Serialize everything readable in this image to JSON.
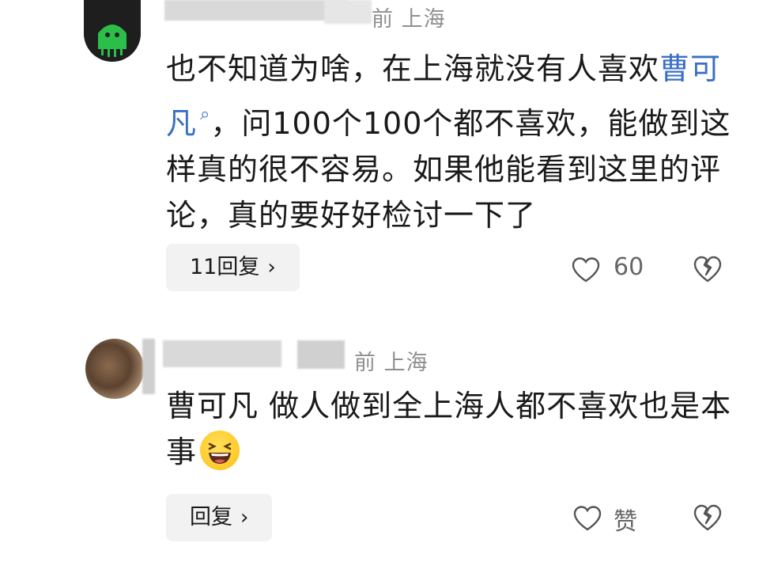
{
  "comments": [
    {
      "location": "前 上海",
      "text_before": "也不知道为啥，在上海就没有人喜欢",
      "mention": "曹可凡",
      "text_after": "，问100个100个都不喜欢，能做到这样真的很不容易。如果他能看到这里的评论，真的要好好检讨一下了",
      "reply_label": "11回复",
      "like_count": "60"
    },
    {
      "location": "前 上海",
      "text": "曹可凡 做人做到全上海人都不喜欢也是本事",
      "emoji": "laughing-face",
      "reply_label": "回复",
      "like_label": "赞"
    }
  ],
  "icons": {
    "reply_chevron": "›",
    "mention_marker": "search-icon"
  }
}
